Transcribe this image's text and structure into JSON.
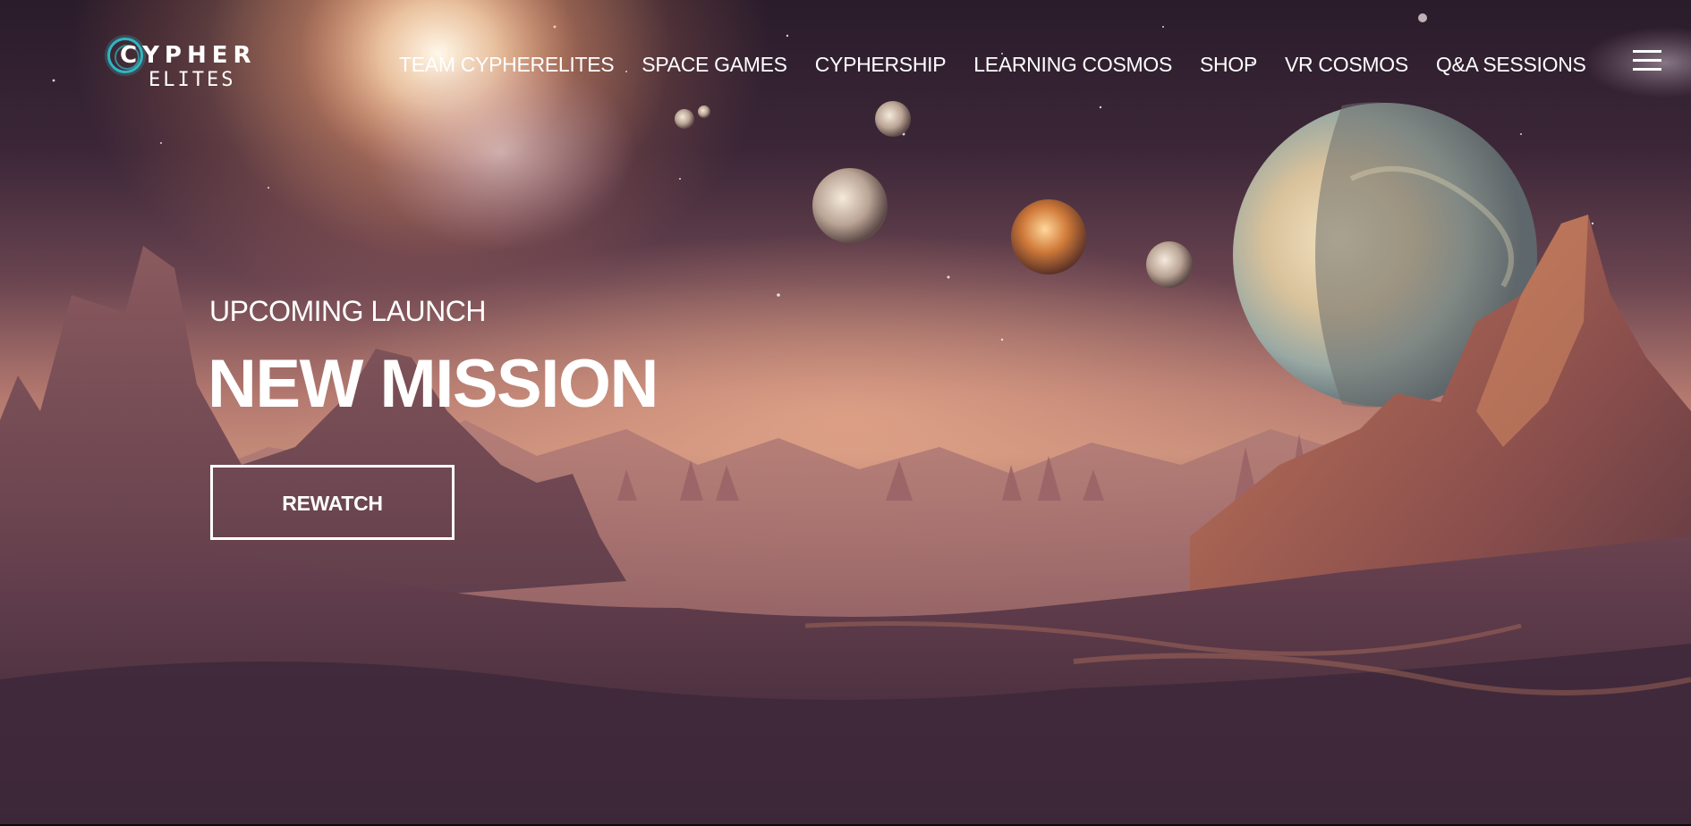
{
  "brand": {
    "logo_top": "CYPHER",
    "logo_bottom": "ELITES"
  },
  "nav": {
    "items": [
      "TEAM CYPHERELITES",
      "SPACE GAMES",
      "CYPHERSHIP",
      "LEARNING COSMOS",
      "SHOP",
      "VR COSMOS",
      "Q&A SESSIONS"
    ]
  },
  "hero": {
    "eyebrow": "UPCOMING LAUNCH",
    "headline": "NEW MISSION",
    "cta_label": "REWATCH"
  },
  "colors": {
    "accent_teal": "#2fb7c4",
    "text": "#ffffff",
    "sky_dark": "#2a1c2b",
    "horizon_glow": "#c48a78",
    "terrain": "#6d4553"
  },
  "icons": {
    "menu": "hamburger-menu-icon",
    "logo": "cypher-ring-logo-icon"
  }
}
